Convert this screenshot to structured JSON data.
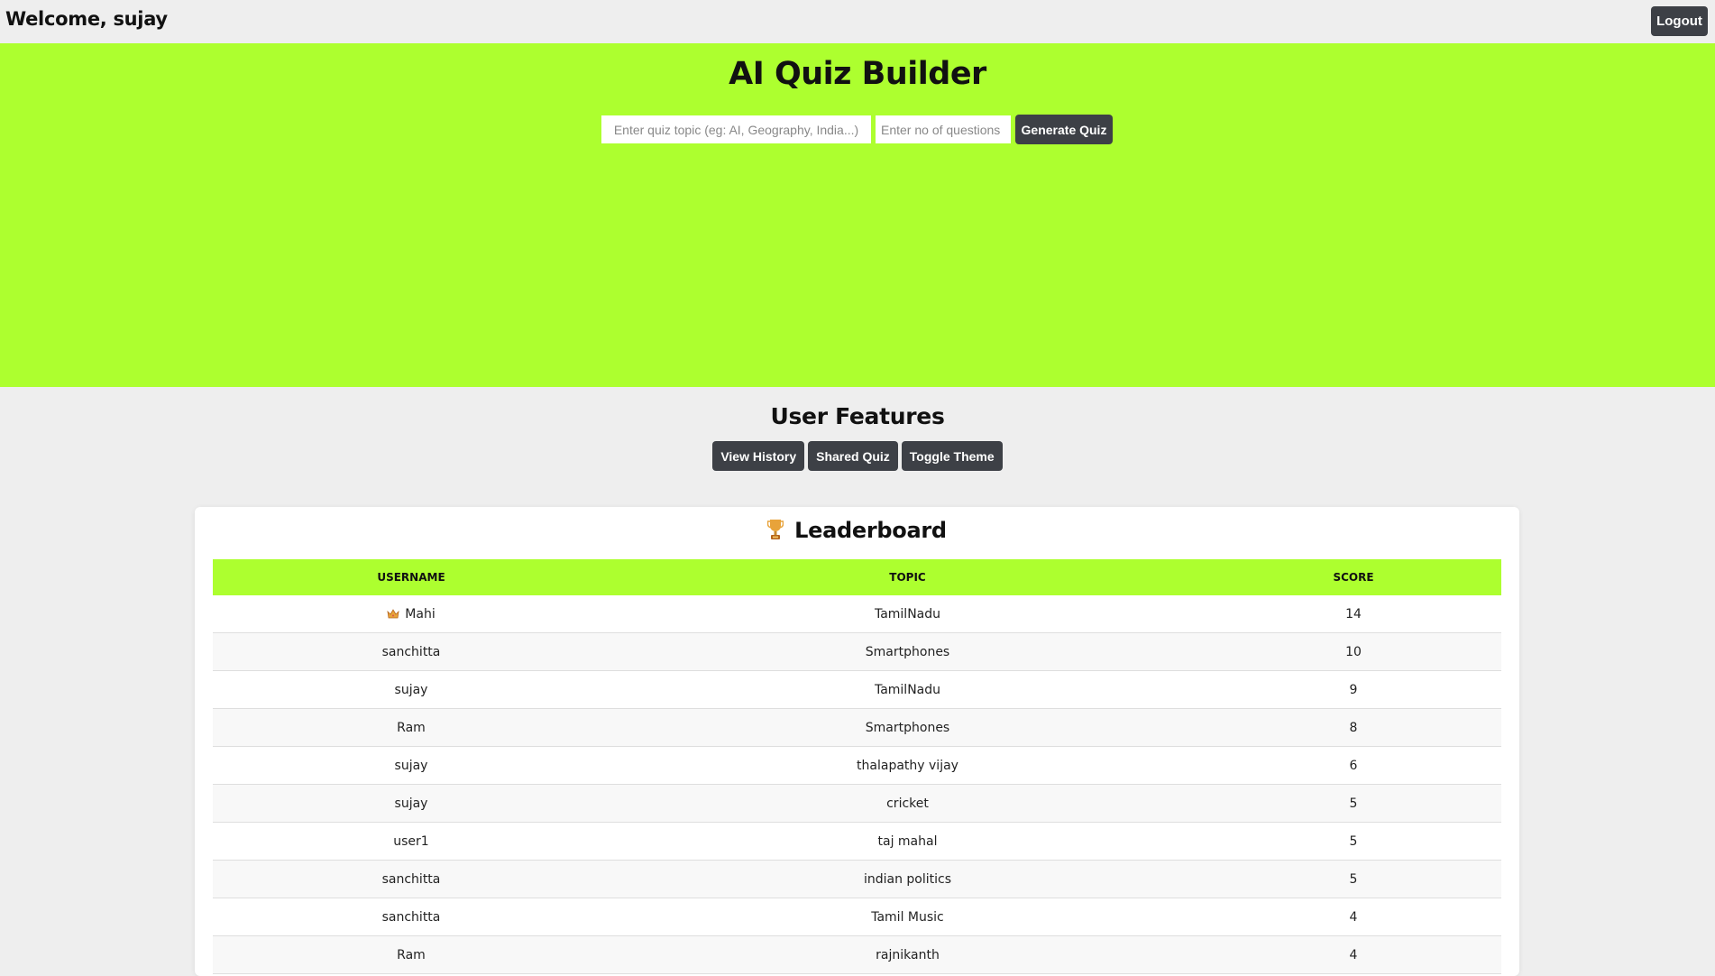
{
  "header": {
    "welcome_text": "Welcome, sujay",
    "logout_label": "Logout"
  },
  "hero": {
    "title": "AI Quiz Builder",
    "topic_placeholder": "Enter quiz topic (eg: AI, Geography, India...)",
    "topic_value": "",
    "count_placeholder": "Enter no of questions",
    "count_value": "",
    "generate_label": "Generate Quiz",
    "background_color": "#adff2f"
  },
  "features": {
    "title": "User Features",
    "buttons": [
      {
        "label": "View History"
      },
      {
        "label": "Shared Quiz"
      },
      {
        "label": "Toggle Theme"
      }
    ]
  },
  "leaderboard": {
    "title": "Leaderboard",
    "trophy_icon": "trophy-icon",
    "columns": [
      "USERNAME",
      "TOPIC",
      "SCORE"
    ],
    "top_rank_icon": "crown-icon",
    "rows": [
      {
        "username": "Mahi",
        "topic": "TamilNadu",
        "score": "14"
      },
      {
        "username": "sanchitta",
        "topic": "Smartphones",
        "score": "10"
      },
      {
        "username": "sujay",
        "topic": "TamilNadu",
        "score": "9"
      },
      {
        "username": "Ram",
        "topic": "Smartphones",
        "score": "8"
      },
      {
        "username": "sujay",
        "topic": "thalapathy vijay",
        "score": "6"
      },
      {
        "username": "sujay",
        "topic": "cricket",
        "score": "5"
      },
      {
        "username": "user1",
        "topic": "taj mahal",
        "score": "5"
      },
      {
        "username": "sanchitta",
        "topic": "indian politics",
        "score": "5"
      },
      {
        "username": "sanchitta",
        "topic": "Tamil Music",
        "score": "4"
      },
      {
        "username": "Ram",
        "topic": "rajnikanth",
        "score": "4"
      }
    ]
  },
  "colors": {
    "accent": "#adff2f",
    "button_dark": "#3d4046",
    "page_background": "#eeeeee"
  }
}
